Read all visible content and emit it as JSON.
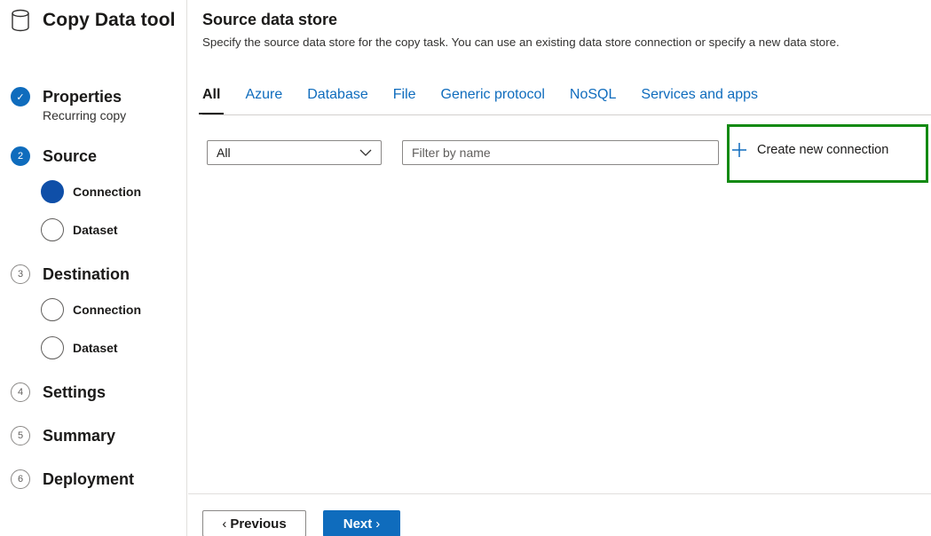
{
  "app": {
    "title": "Copy Data tool",
    "icon": "database-icon"
  },
  "steps": [
    {
      "number": "✓",
      "label": "Properties",
      "sub": "Recurring copy",
      "state": "done"
    },
    {
      "number": "2",
      "label": "Source",
      "state": "active",
      "substeps": [
        {
          "label": "Connection",
          "state": "active"
        },
        {
          "label": "Dataset",
          "state": "pending"
        }
      ]
    },
    {
      "number": "3",
      "label": "Destination",
      "state": "pending",
      "substeps": [
        {
          "label": "Connection",
          "state": "pending"
        },
        {
          "label": "Dataset",
          "state": "pending"
        }
      ]
    },
    {
      "number": "4",
      "label": "Settings",
      "state": "pending"
    },
    {
      "number": "5",
      "label": "Summary",
      "state": "pending"
    },
    {
      "number": "6",
      "label": "Deployment",
      "state": "pending"
    }
  ],
  "main": {
    "title": "Source data store",
    "description": "Specify the source data store for the copy task. You can use an existing data store connection or specify a new data store.",
    "tabs": [
      "All",
      "Azure",
      "Database",
      "File",
      "Generic protocol",
      "NoSQL",
      "Services and apps"
    ],
    "selected_tab": "All",
    "type_select": {
      "value": "All"
    },
    "filter": {
      "placeholder": "Filter by name",
      "value": ""
    },
    "create_button": "Create new connection"
  },
  "footer": {
    "previous": "Previous",
    "next": "Next"
  },
  "colors": {
    "accent": "#0f6cbd",
    "highlight_box": "#138a13"
  }
}
